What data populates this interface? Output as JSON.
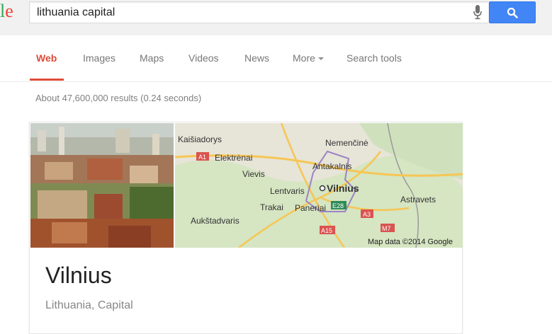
{
  "search": {
    "query": "lithuania capital",
    "logo_fragment_1": "l",
    "logo_fragment_2": "e"
  },
  "tabs": [
    {
      "label": "Web",
      "active": true
    },
    {
      "label": "Images"
    },
    {
      "label": "Maps"
    },
    {
      "label": "Videos"
    },
    {
      "label": "News"
    },
    {
      "label": "More"
    },
    {
      "label": "Search tools"
    }
  ],
  "result_stats": "About 47,600,000 results (0.24 seconds)",
  "knowledge_panel": {
    "title": "Vilnius",
    "subtitle": "Lithuania, Capital",
    "map": {
      "places": [
        "Kaišiadorys",
        "Nemenčinė",
        "Elektrėnai",
        "Antakalnis",
        "Vievis",
        "Lentvaris",
        "Vilnius",
        "Astravets",
        "Trakai",
        "Paneriai",
        "Aukštadvaris"
      ],
      "roads": [
        "A1",
        "E28",
        "A3",
        "A15",
        "M7"
      ],
      "attribution": "Map data ©2014 Google"
    }
  },
  "colors": {
    "active_tab": "#dd4b39",
    "search_button": "#4285f4",
    "topbar": "#f1f1f1"
  }
}
